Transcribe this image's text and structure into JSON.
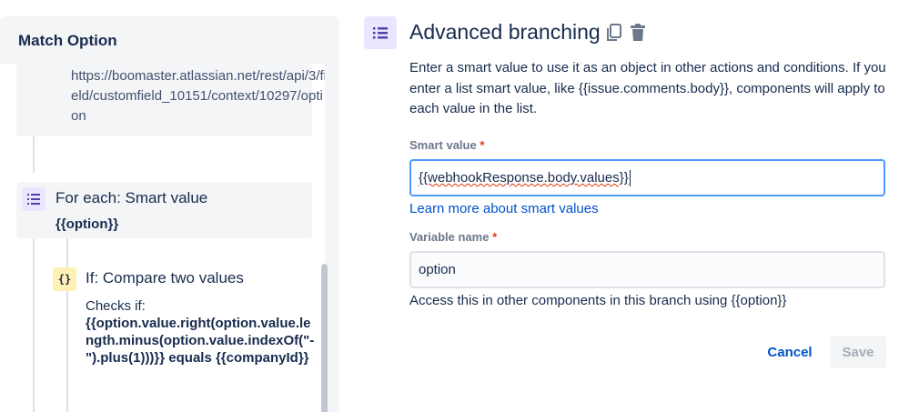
{
  "left_panel": {
    "title": "Match Option",
    "url_text": "https://boomaster.atlassian.net/rest/api/3/field/customfield_10151/context/10297/option",
    "for_each": {
      "title": "For each: Smart value",
      "value": "{{option}}",
      "icon": "list-icon"
    },
    "if_compare": {
      "title": "If: Compare two values",
      "icon_glyph": "{}",
      "checks_label": "Checks if:",
      "checks_expression": "{{option.value.right(option.value.length.minus(option.value.indexOf(\"-\").plus(1)))}} equals {{companyId}}"
    }
  },
  "right_panel": {
    "title": "Advanced branching",
    "description": "Enter a smart value to use it as an object in other actions and conditions. If you enter a list smart value, like {{issue.comments.body}}, components will apply to each value in the list.",
    "smart_value_label": "Smart value",
    "smart_value": "{{webhookResponse.body.values}}",
    "learn_more_link": "Learn more about smart values",
    "variable_name_label": "Variable name",
    "variable_name_value": "option",
    "helper_text": "Access this in other components in this branch using {{option}}",
    "required_marker": "*",
    "cancel_label": "Cancel",
    "save_label": "Save"
  },
  "colors": {
    "accent": "#0052cc",
    "focus_border": "#4c9aff",
    "purple_icon_bg": "#eae6ff",
    "yellow_icon_bg": "#fff0b3",
    "required": "#de350b"
  }
}
